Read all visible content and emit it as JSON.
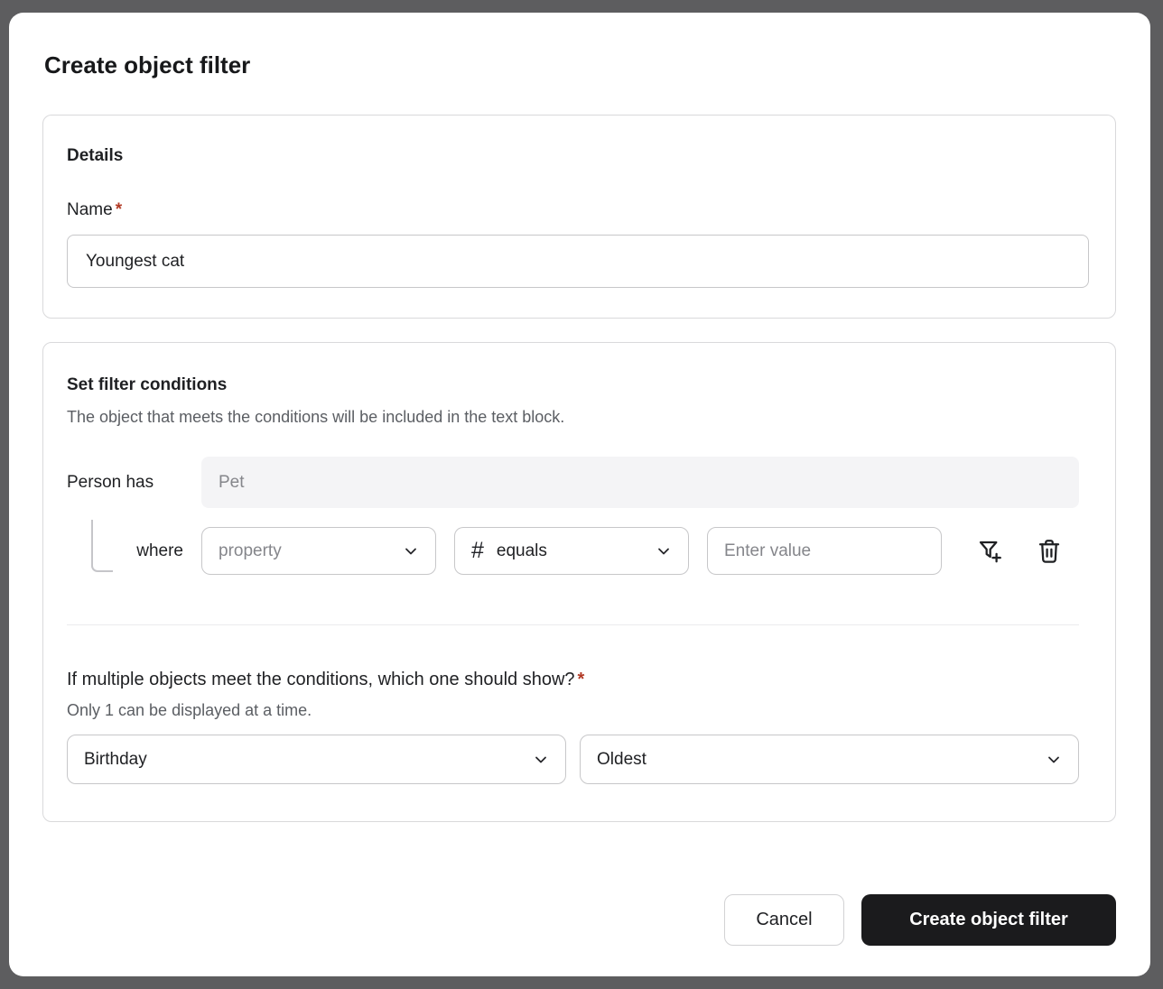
{
  "dialog": {
    "title": "Create object filter",
    "details_section": {
      "heading": "Details",
      "name_label": "Name",
      "required_marker": "*",
      "name_value": "Youngest cat"
    },
    "conditions_section": {
      "heading": "Set filter conditions",
      "description": "The object that meets the conditions will be included in the text block.",
      "object_row": {
        "label": "Person has",
        "object_value": "Pet"
      },
      "condition_row": {
        "label": "where",
        "property_placeholder": "property",
        "operator_icon_glyph": "#",
        "operator_value": "equals",
        "value_placeholder": "Enter value"
      },
      "selection": {
        "question": "If multiple objects meet the conditions, which one should show?",
        "required_marker": "*",
        "note": "Only 1 can be displayed at a time.",
        "sort_property_value": "Birthday",
        "sort_order_value": "Oldest"
      }
    },
    "footer": {
      "cancel_label": "Cancel",
      "submit_label": "Create object filter"
    },
    "colors": {
      "backdrop": "#5d5d5f",
      "required": "#b23a25",
      "submit_bg": "#1b1b1d",
      "muted_text": "#85868b",
      "border": "#c7c7c9"
    }
  }
}
